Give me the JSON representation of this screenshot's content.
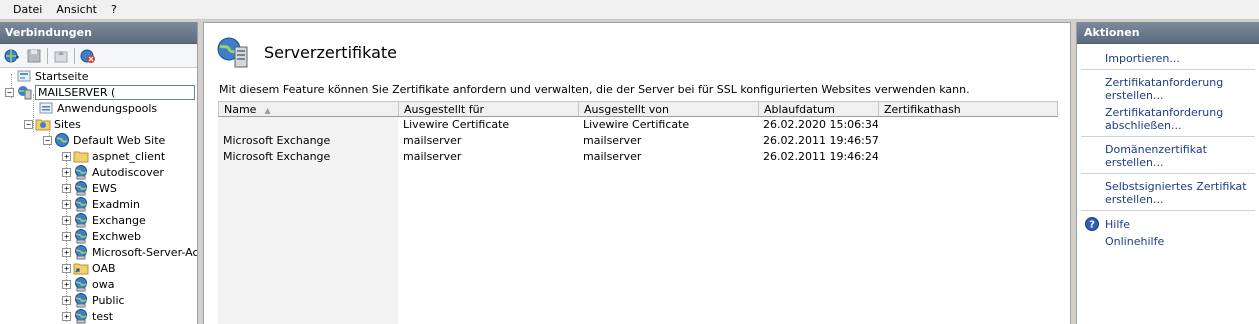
{
  "menu": {
    "items": [
      "Datei",
      "Ansicht",
      "?"
    ]
  },
  "left": {
    "header": "Verbindungen",
    "tree": [
      {
        "label": "Startseite",
        "icon": "home-icon",
        "level": 0,
        "expander": ""
      },
      {
        "label": "MAILSERVER (",
        "icon": "server-icon",
        "level": 0,
        "expander": "−",
        "selected": true
      },
      {
        "label": "Anwendungspools",
        "icon": "app-pool-icon",
        "level": 1,
        "expander": ""
      },
      {
        "label": "Sites",
        "icon": "sites-folder-icon",
        "level": 1,
        "expander": "−"
      },
      {
        "label": "Default Web Site",
        "icon": "globe-icon",
        "level": 2,
        "expander": "−"
      },
      {
        "label": "aspnet_client",
        "icon": "folder-icon",
        "level": 3,
        "expander": "+"
      },
      {
        "label": "Autodiscover",
        "icon": "web-app-icon",
        "level": 3,
        "expander": "+"
      },
      {
        "label": "EWS",
        "icon": "web-app-icon",
        "level": 3,
        "expander": "+"
      },
      {
        "label": "Exadmin",
        "icon": "web-app-icon",
        "level": 3,
        "expander": "+"
      },
      {
        "label": "Exchange",
        "icon": "web-app-icon",
        "level": 3,
        "expander": "+"
      },
      {
        "label": "Exchweb",
        "icon": "web-app-icon",
        "level": 3,
        "expander": "+"
      },
      {
        "label": "Microsoft-Server-Act",
        "icon": "web-app-icon",
        "level": 3,
        "expander": "+"
      },
      {
        "label": "OAB",
        "icon": "virtual-dir-icon",
        "level": 3,
        "expander": "+"
      },
      {
        "label": "owa",
        "icon": "web-app-icon",
        "level": 3,
        "expander": "+"
      },
      {
        "label": "Public",
        "icon": "web-app-icon",
        "level": 3,
        "expander": "+"
      },
      {
        "label": "test",
        "icon": "web-app-icon",
        "level": 3,
        "expander": "+"
      }
    ]
  },
  "center": {
    "title": "Serverzertifikate",
    "description": "Mit diesem Feature können Sie Zertifikate anfordern und verwalten, die der Server bei für SSL konfigurierten Websites verwenden kann.",
    "columns": [
      "Name",
      "Ausgestellt für",
      "Ausgestellt von",
      "Ablaufdatum",
      "Zertifikathash"
    ],
    "rows": [
      [
        "",
        "Livewire Certificate",
        "Livewire Certificate",
        "26.02.2020 15:06:34",
        ""
      ],
      [
        "Microsoft Exchange",
        "mailserver",
        "mailserver",
        "26.02.2011 19:46:57",
        ""
      ],
      [
        "Microsoft Exchange",
        "mailserver",
        "mailserver",
        "26.02.2011 19:46:24",
        ""
      ]
    ]
  },
  "right": {
    "header": "Aktionen",
    "actions": {
      "import": "Importieren...",
      "create_request": "Zertifikatanforderung erstellen...",
      "complete_request": "Zertifikatanforderung abschließen...",
      "domain_cert": "Domänenzertifikat erstellen...",
      "self_signed": "Selbstsigniertes Zertifikat erstellen...",
      "help": "Hilfe",
      "online_help": "Onlinehilfe"
    }
  },
  "colors": {
    "accent_header": "#5d6b7e",
    "link": "#1c3d88"
  }
}
